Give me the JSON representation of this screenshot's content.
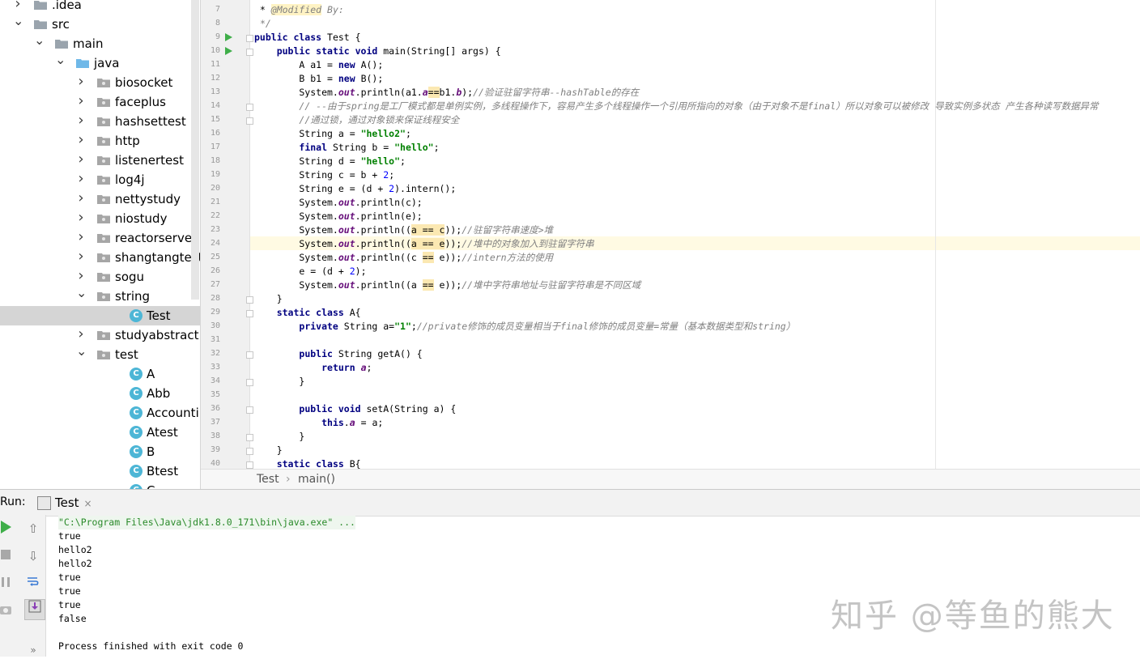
{
  "tree": {
    "rows": [
      {
        "label": ".idea",
        "type": "folder",
        "expanded": false,
        "depth": 0
      },
      {
        "label": "src",
        "type": "folder",
        "expanded": true,
        "depth": 0
      },
      {
        "label": "main",
        "type": "folder",
        "expanded": true,
        "depth": 1
      },
      {
        "label": "java",
        "type": "folder-source",
        "expanded": true,
        "depth": 2
      },
      {
        "label": "biosocket",
        "type": "package",
        "expanded": false,
        "depth": 3
      },
      {
        "label": "faceplus",
        "type": "package",
        "expanded": false,
        "depth": 3
      },
      {
        "label": "hashsettest",
        "type": "package",
        "expanded": false,
        "depth": 3
      },
      {
        "label": "http",
        "type": "package",
        "expanded": false,
        "depth": 3
      },
      {
        "label": "listenertest",
        "type": "package",
        "expanded": false,
        "depth": 3
      },
      {
        "label": "log4j",
        "type": "package",
        "expanded": false,
        "depth": 3
      },
      {
        "label": "nettystudy",
        "type": "package",
        "expanded": false,
        "depth": 3
      },
      {
        "label": "niostudy",
        "type": "package",
        "expanded": false,
        "depth": 3
      },
      {
        "label": "reactorserver",
        "type": "package",
        "expanded": false,
        "depth": 3
      },
      {
        "label": "shangtangtest",
        "type": "package",
        "expanded": false,
        "depth": 3
      },
      {
        "label": "sogu",
        "type": "package",
        "expanded": false,
        "depth": 3
      },
      {
        "label": "string",
        "type": "package",
        "expanded": true,
        "depth": 3
      },
      {
        "label": "Test",
        "type": "class",
        "depth": 4,
        "selected": true
      },
      {
        "label": "studyabstract",
        "type": "package",
        "expanded": false,
        "depth": 3
      },
      {
        "label": "test",
        "type": "package",
        "expanded": true,
        "depth": 3
      },
      {
        "label": "A",
        "type": "class",
        "depth": 4
      },
      {
        "label": "Abb",
        "type": "class",
        "depth": 4
      },
      {
        "label": "AccountingF",
        "type": "class",
        "depth": 4
      },
      {
        "label": "Atest",
        "type": "class",
        "depth": 4
      },
      {
        "label": "B",
        "type": "class",
        "depth": 4
      },
      {
        "label": "Btest",
        "type": "class",
        "depth": 4
      },
      {
        "label": "C",
        "type": "class",
        "depth": 4
      }
    ]
  },
  "editor": {
    "lines": [
      {
        "n": "7",
        "html": " * <span class=\"c\" style=\"background:#fff3c4\">@Modified</span><span class=\"c\"> By:</span>"
      },
      {
        "n": "8",
        "html": " <span class=\"c\">*/</span>"
      },
      {
        "n": "9",
        "html": "<span class=\"k\">public class</span> Test {",
        "run": true,
        "fold": true
      },
      {
        "n": "10",
        "html": "    <span class=\"k\">public static void</span> main(String[] args) {",
        "run": true,
        "fold": true
      },
      {
        "n": "11",
        "html": "        A a1 = <span class=\"k\">new</span> A();"
      },
      {
        "n": "12",
        "html": "        B b1 = <span class=\"k\">new</span> B();"
      },
      {
        "n": "13",
        "html": "        System.<span class=\"f\">out</span>.println(a1.<span class=\"f\">a</span><span class=\"hl\">==</span>b1.<span class=\"f\">b</span>);<span class=\"c\">//验证驻留字符串--hashTable的存在</span>"
      },
      {
        "n": "14",
        "html": "        <span class=\"c\">// --由于spring是工厂模式都是单例实例，多线程操作下，容易产生多个线程操作一个引用所指向的对象（由于对象不是final）所以对象可以被修改 导致实例多状态 产生各种读写数据异常</span>",
        "fold": true
      },
      {
        "n": "15",
        "html": "        <span class=\"c\">//通过锁，通过对象锁来保证线程安全</span>",
        "fold": true
      },
      {
        "n": "16",
        "html": "        String a = <span class=\"s\">\"hello2\"</span>;"
      },
      {
        "n": "17",
        "html": "        <span class=\"k\">final</span> String b = <span class=\"s\">\"hello\"</span>;"
      },
      {
        "n": "18",
        "html": "        String d = <span class=\"s\">\"hello\"</span>;"
      },
      {
        "n": "19",
        "html": "        String c = b + <span class=\"n\">2</span>;"
      },
      {
        "n": "20",
        "html": "        String e = (d + <span class=\"n\">2</span>).intern();"
      },
      {
        "n": "21",
        "html": "        System.<span class=\"f\">out</span>.println(c);"
      },
      {
        "n": "22",
        "html": "        System.<span class=\"f\">out</span>.println(e);"
      },
      {
        "n": "23",
        "html": "        System.<span class=\"f\">out</span>.println((<span class=\"hl\">a == c</span>));<span class=\"c\">//驻留字符串速度&gt;堆</span>"
      },
      {
        "n": "24",
        "html": "        System.<span class=\"f\">out</span>.println((<span class=\"hl\">a == e</span>));<span class=\"c\">//堆中的对象加入到驻留字符串</span>"
      },
      {
        "n": "25",
        "html": "        System.<span class=\"f\">out</span>.println((c <span class=\"hl\">==</span> e));<span class=\"c\">//intern方法的使用</span>"
      },
      {
        "n": "26",
        "html": "        e = (d + <span class=\"n\">2</span>);"
      },
      {
        "n": "27",
        "html": "        System.<span class=\"f\">out</span>.println((a <span class=\"hl\">==</span> e));<span class=\"c\">//堆中字符串地址与驻留字符串是不同区域</span>"
      },
      {
        "n": "28",
        "html": "    }",
        "fold": true
      },
      {
        "n": "29",
        "html": "    <span class=\"k\">static class</span> A{",
        "fold": true
      },
      {
        "n": "30",
        "html": "        <span class=\"k\">private</span> String a=<span class=\"s\">\"1\"</span>;<span class=\"c\">//private修饰的成员变量相当于final修饰的成员变量=常量（基本数据类型和string）</span>"
      },
      {
        "n": "31",
        "html": ""
      },
      {
        "n": "32",
        "html": "        <span class=\"k\">public</span> String getA() {",
        "fold": true
      },
      {
        "n": "33",
        "html": "            <span class=\"k\">return</span> <span class=\"f\">a</span>;"
      },
      {
        "n": "34",
        "html": "        }",
        "fold": true
      },
      {
        "n": "35",
        "html": ""
      },
      {
        "n": "36",
        "html": "        <span class=\"k\">public void</span> setA(String a) {",
        "fold": true
      },
      {
        "n": "37",
        "html": "            <span class=\"k\">this</span>.<span class=\"f\">a</span> = a;"
      },
      {
        "n": "38",
        "html": "        }",
        "fold": true
      },
      {
        "n": "39",
        "html": "    }",
        "fold": true
      },
      {
        "n": "40",
        "html": "    <span class=\"k\">static class</span> B{",
        "fold": true
      }
    ]
  },
  "breadcrumb": {
    "class": "Test",
    "sep": "›",
    "method": "main()"
  },
  "run": {
    "label": "Run:",
    "tab": "Test",
    "tab_close": "×",
    "console": [
      "\"C:\\Program Files\\Java\\jdk1.8.0_171\\bin\\java.exe\" ...",
      "true",
      "hello2",
      "hello2",
      "true",
      "true",
      "true",
      "false",
      "",
      "Process finished with exit code 0"
    ]
  },
  "watermark": "知乎 @等鱼的熊大",
  "colors": {
    "keyword": "#000080",
    "string": "#008000",
    "comment": "#808080",
    "field": "#660e7a",
    "run_green": "#3fae49"
  }
}
